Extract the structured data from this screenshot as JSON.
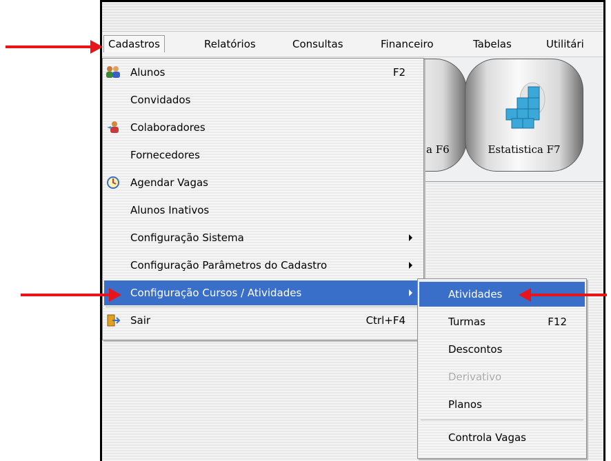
{
  "menubar": {
    "items": [
      {
        "label": "Cadastros"
      },
      {
        "label": "Relatórios"
      },
      {
        "label": "Consultas"
      },
      {
        "label": "Financeiro"
      },
      {
        "label": "Tabelas"
      },
      {
        "label": "Utilitári"
      }
    ]
  },
  "toolbar": {
    "buttons": [
      {
        "label": "a F6"
      },
      {
        "label": "Estatistica F7",
        "icon": "cube-stack-icon"
      }
    ]
  },
  "dropdown": {
    "items": [
      {
        "label": "Alunos",
        "shortcut": "F2",
        "icon": "users-icon"
      },
      {
        "label": "Convidados",
        "shortcut": ""
      },
      {
        "label": "Colaboradores",
        "shortcut": "",
        "icon": "collaborator-icon"
      },
      {
        "label": "Fornecedores",
        "shortcut": ""
      },
      {
        "label": "Agendar Vagas",
        "shortcut": "",
        "icon": "schedule-icon"
      },
      {
        "label": "Alunos Inativos",
        "shortcut": ""
      },
      {
        "label": "Configuração Sistema",
        "has_submenu": true
      },
      {
        "label": "Configuração Parâmetros do Cadastro",
        "has_submenu": true
      },
      {
        "label": "Configuração Cursos / Atividades",
        "has_submenu": true,
        "selected": true
      },
      {
        "label": "Sair",
        "shortcut": "Ctrl+F4",
        "icon": "exit-icon"
      }
    ]
  },
  "submenu": {
    "items": [
      {
        "label": "Atividades",
        "shortcut": "",
        "selected": true
      },
      {
        "label": "Turmas",
        "shortcut": "F12"
      },
      {
        "label": "Descontos",
        "shortcut": ""
      },
      {
        "label": "Derivativo",
        "shortcut": "",
        "disabled": true
      },
      {
        "label": "Planos",
        "shortcut": ""
      },
      {
        "label": "Controla Vagas",
        "shortcut": ""
      }
    ]
  },
  "colors": {
    "selection": "#3a6fc9",
    "annotation_arrow": "#e8141c"
  }
}
